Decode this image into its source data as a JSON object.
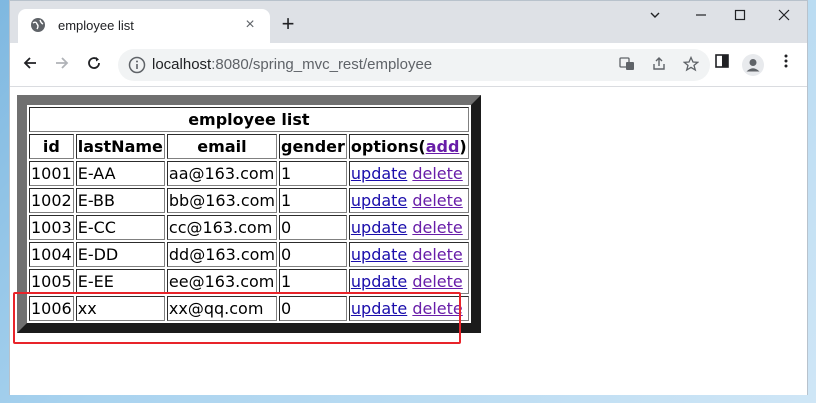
{
  "browser": {
    "tab_title": "employee list",
    "tab_close": "×",
    "new_tab": "+",
    "url_host": "localhost",
    "url_path": ":8080/spring_mvc_rest/employee"
  },
  "table": {
    "caption": "employee list",
    "headers": {
      "id": "id",
      "lastName": "lastName",
      "email": "email",
      "gender": "gender",
      "options_prefix": "options(",
      "options_add": "add",
      "options_suffix": ")"
    },
    "rows": [
      {
        "id": "1001",
        "lastName": "E-AA",
        "email": "aa@163.com",
        "gender": "1",
        "update": "update",
        "delete": "delete"
      },
      {
        "id": "1002",
        "lastName": "E-BB",
        "email": "bb@163.com",
        "gender": "1",
        "update": "update",
        "delete": "delete"
      },
      {
        "id": "1003",
        "lastName": "E-CC",
        "email": "cc@163.com",
        "gender": "0",
        "update": "update",
        "delete": "delete"
      },
      {
        "id": "1004",
        "lastName": "E-DD",
        "email": "dd@163.com",
        "gender": "0",
        "update": "update",
        "delete": "delete"
      },
      {
        "id": "1005",
        "lastName": "E-EE",
        "email": "ee@163.com",
        "gender": "1",
        "update": "update",
        "delete": "delete"
      },
      {
        "id": "1006",
        "lastName": "xx",
        "email": "xx@qq.com",
        "gender": "0",
        "update": "update",
        "delete": "delete"
      }
    ]
  },
  "colors": {
    "highlight": "#e8242a",
    "link": "#1a0dab",
    "visited_link": "#681da8"
  }
}
